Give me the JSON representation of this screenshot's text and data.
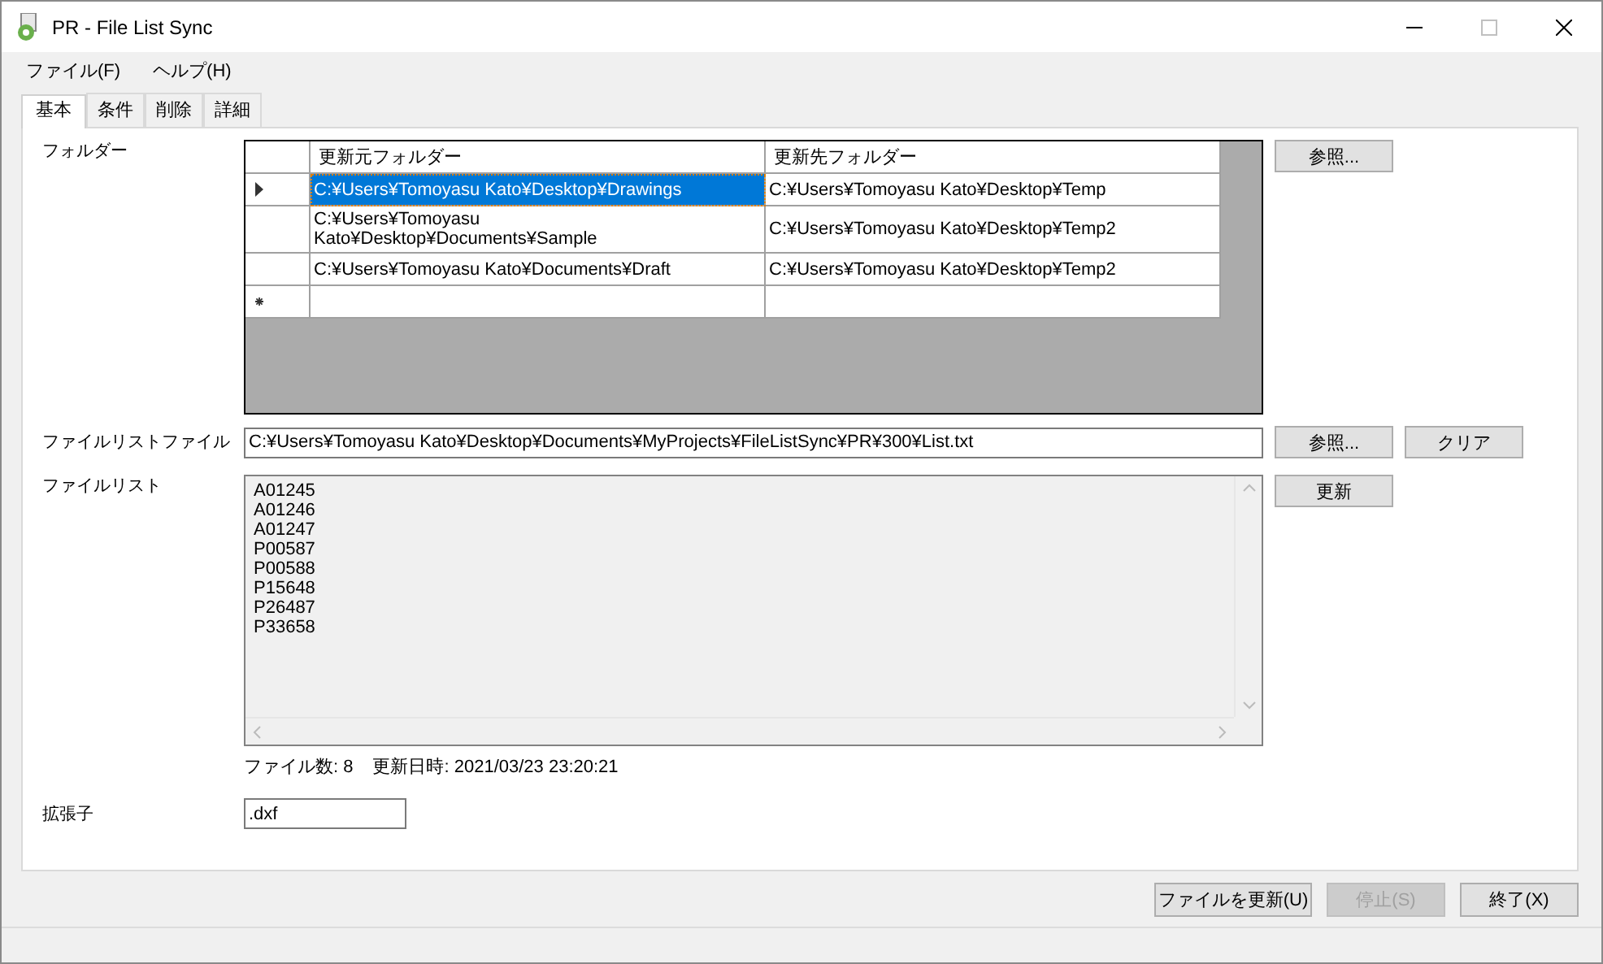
{
  "window": {
    "title": "PR - File List Sync"
  },
  "menu": [
    "ファイル(F)",
    "ヘルプ(H)"
  ],
  "tabs": [
    {
      "label": "基本",
      "selected": true
    },
    {
      "label": "条件",
      "selected": false
    },
    {
      "label": "削除",
      "selected": false
    },
    {
      "label": "詳細",
      "selected": false
    }
  ],
  "folders": {
    "label": "フォルダー",
    "columns": [
      "更新元フォルダー",
      "更新先フォルダー"
    ],
    "rows": [
      {
        "kind": "data",
        "current": true,
        "selected": true,
        "source": "C:¥Users¥Tomoyasu Kato¥Desktop¥Drawings",
        "target": "C:¥Users¥Tomoyasu Kato¥Desktop¥Temp"
      },
      {
        "kind": "data",
        "current": false,
        "selected": false,
        "source": "C:¥Users¥Tomoyasu Kato¥Desktop¥Documents¥Sample",
        "target": "C:¥Users¥Tomoyasu Kato¥Desktop¥Temp2"
      },
      {
        "kind": "data",
        "current": false,
        "selected": false,
        "source": "C:¥Users¥Tomoyasu Kato¥Documents¥Draft",
        "target": "C:¥Users¥Tomoyasu Kato¥Desktop¥Temp2"
      },
      {
        "kind": "new",
        "selected": false
      }
    ],
    "browse_button": "参照..."
  },
  "file_list_file": {
    "label": "ファイルリストファイル",
    "value": "C:¥Users¥Tomoyasu Kato¥Desktop¥Documents¥MyProjects¥FileListSync¥PR¥300¥List.txt",
    "browse_button": "参照...",
    "clear_button": "クリア"
  },
  "file_list": {
    "label": "ファイルリスト",
    "items": [
      "A01245",
      "A01246",
      "A01247",
      "P00587",
      "P00588",
      "P15648",
      "P26487",
      "P33658"
    ],
    "refresh_button": "更新",
    "count": "ファイル数: 8",
    "updated": "更新日時: 2021/03/23 23:20:21"
  },
  "extension": {
    "label": "拡張子",
    "value": ".dxf"
  },
  "buttons": [
    {
      "label": "ファイルを更新(U)",
      "disabled": false
    },
    {
      "label": "停止(S)",
      "disabled": true
    },
    {
      "label": "終了(X)",
      "disabled": false
    }
  ]
}
